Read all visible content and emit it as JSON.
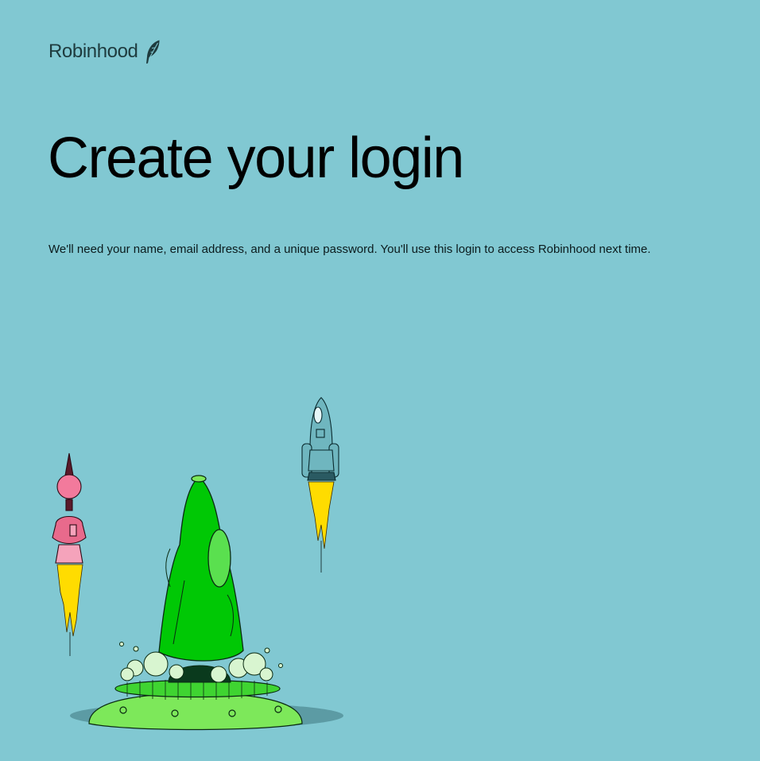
{
  "brand": {
    "name": "Robinhood",
    "logo_icon": "feather-icon"
  },
  "page": {
    "title": "Create your login",
    "description": "We'll need your name, email address, and a unique password. You'll use this login to access Robinhood next time."
  },
  "illustration": {
    "name": "rocket-launch-illustration",
    "colors": {
      "background": "#81c8d2",
      "main_rocket": "#00c805",
      "pad": "#7de85a",
      "pink_rocket": "#e86a8c",
      "teal_rocket": "#6fb6bf",
      "flame": "#ffdc00"
    }
  }
}
